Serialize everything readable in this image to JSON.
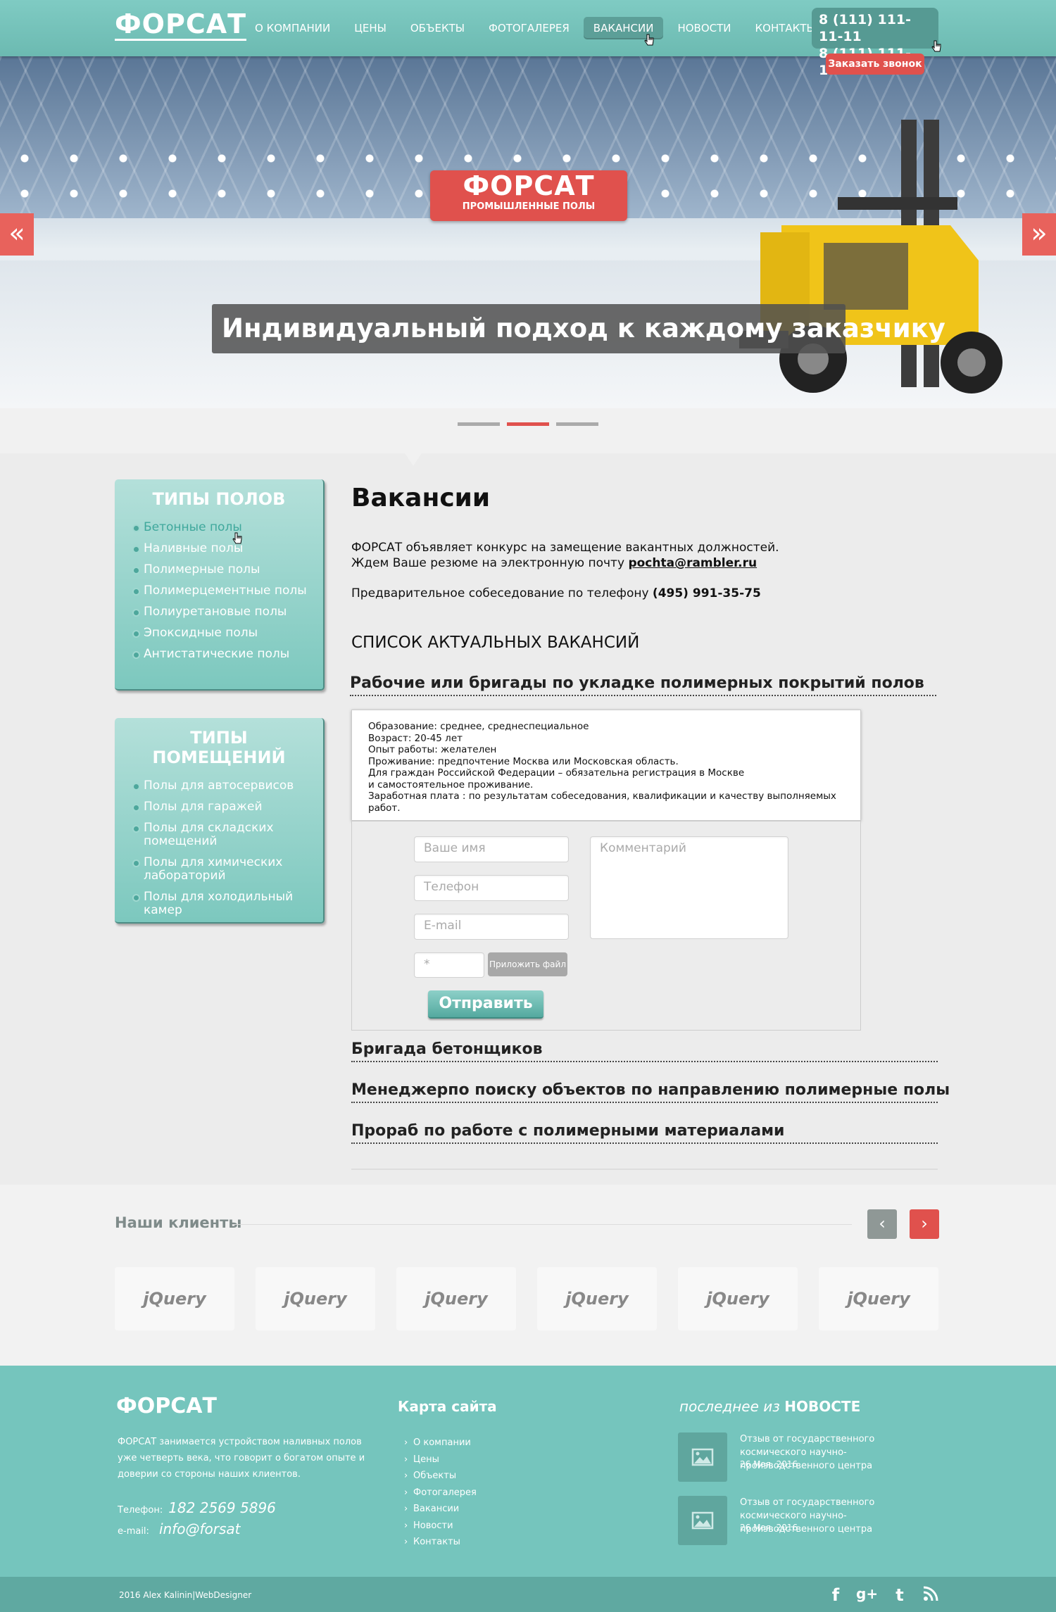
{
  "header": {
    "logo": "ФОРСАТ",
    "nav": [
      "О КОМПАНИИ",
      "ЦЕНЫ",
      "ОБЪЕКТЫ",
      "ФОТОГАЛЕРЕЯ",
      "ВАКАНСИИ",
      "НОВОСТИ",
      "КОНТАКТЫ"
    ],
    "active_nav": "ВАКАНСИИ",
    "phones": [
      "8 (111) 111-11-11",
      "8 (111) 111-11-11"
    ],
    "call_button": "Заказать звонок"
  },
  "slider": {
    "brand": "ФОРСАТ",
    "brand_sub": "ПРОМЫШЛЕННЫЕ ПОЛЫ",
    "caption": "Индивидуальный подход к каждому заказчику",
    "prev_icon": "«",
    "next_icon": "»",
    "slides": 3,
    "active_slide": 2
  },
  "sidebar": {
    "floors_title": "ТИПЫ ПОЛОВ",
    "floors": [
      "Бетонные полы",
      "Наливные полы",
      "Полимерные полы",
      "Полимерцементные полы",
      "Полиуретановые полы",
      "Эпоксидные полы",
      "Антистатические полы"
    ],
    "rooms_title": "ТИПЫ ПОМЕЩЕНИЙ",
    "rooms": [
      "Полы для автосервисов",
      "Полы для гаражей",
      "Полы для складских помещений",
      "Полы для химических лабораторий",
      "Полы для холодильный камер"
    ]
  },
  "main": {
    "title": "Вакансии",
    "intro1": "ФОРСАТ объявляет конкурс на замещение вакантных должностей.",
    "intro2": "Ждем Ваше резюме на электронную почту ",
    "email": "pochta@rambler.ru",
    "intro3": "Предварительное собеседование по телефону ",
    "phone": "(495) 991-35-75",
    "list_title": "СПИСОК АКТУАЛЬНЫХ ВАКАНСИЙ",
    "vacancies": [
      "Рабочие или бригады по укладке полимерных покрытий полов",
      "Бригада бетонщиков",
      "Менеджерпо поиску объектов по направлению полимерные полы",
      "Прораб по работе с полимерными материалами"
    ],
    "details": [
      "Образование: среднее, среднеспециальное",
      "Возраст: 20-45 лет",
      "Опыт работы: желателен",
      "Проживание: предпочтение Москва или Московская область.",
      "Для граждан Российской Федерации – обязательна регистрация в Москве",
      "и самостоятельное проживание.",
      "Заработная плата : по результатам собеседования, квалификации и качеству выполняемых работ."
    ],
    "form": {
      "name_placeholder": "Ваше имя",
      "phone_placeholder": "Телефон",
      "email_placeholder": "E-mail",
      "comment_placeholder": "Комментарий",
      "captcha_placeholder": "*",
      "file_button": "Приложить файл",
      "submit": "Отправить"
    }
  },
  "clients": {
    "title": "Наши клиенты",
    "logos": [
      "jQuery",
      "jQuery",
      "jQuery",
      "jQuery",
      "jQuery",
      "jQuery"
    ],
    "prev_icon": "‹",
    "next_icon": "›"
  },
  "footer": {
    "brand": "ФОРСАТ",
    "about": "ФОРСАТ занимается устройством наливных полов уже четверть века, что говорит о богатом опыте и доверии со стороны наших клиентов.",
    "phone_label": "Телефон:",
    "phone": "182 2569 5896",
    "email_label": "e-mail:",
    "email": "info@forsat",
    "map_title": "Карта сайта",
    "map": [
      "О компании",
      "Цены",
      "Объекты",
      "Фотогалерея",
      "Вакансии",
      "Новости",
      "Контакты"
    ],
    "news_title_pre": "последнее из",
    "news_title": "НОВОСТЕ",
    "news": [
      {
        "title": "Отзыв от государственного космического научно-производственного центра",
        "date": "26 Мая, 2016"
      },
      {
        "title": "Отзыв от государственного космического научно-производственного центра",
        "date": "26 Мая, 2016"
      }
    ],
    "copyright": "2016 Alex Kalinin|WebDesigner",
    "social": [
      "facebook-icon",
      "google-plus-icon",
      "twitter-icon",
      "rss-icon"
    ]
  },
  "colors": {
    "teal": "#75c5bd",
    "accent_red": "#e0514d",
    "dark_teal": "#569a93"
  }
}
